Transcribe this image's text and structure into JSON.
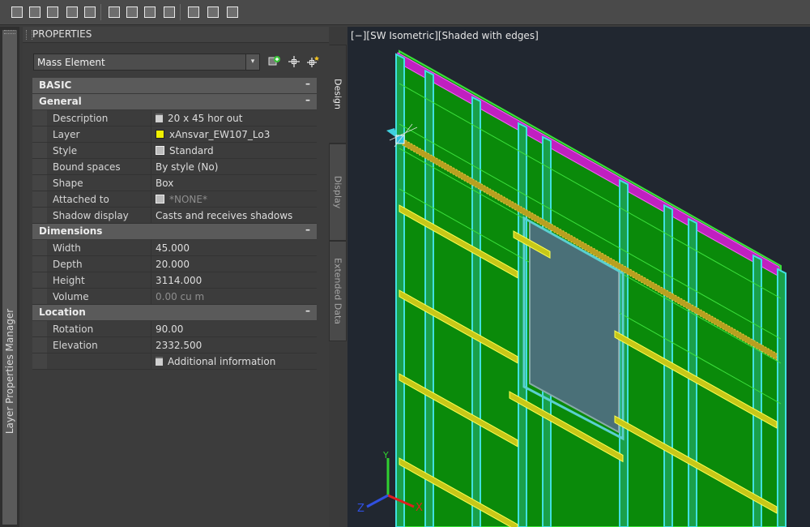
{
  "toolbar": {
    "buttons": [
      "new-object-icon",
      "refresh-icon",
      "zoom-icon",
      "edit-style-icon",
      "check-icon",
      "properties-edit-icon",
      "style-manager-icon",
      "display-manager-icon",
      "render-icon",
      "layer-icon",
      "command-line-icon",
      "settings-gear-icon"
    ]
  },
  "sidebar": {
    "label": "Layer Properties Manager"
  },
  "panel": {
    "title": "PROPERTIES",
    "object_type": "Mass Element",
    "buttons": [
      "select-objects-icon",
      "pick-point-icon",
      "quick-select-icon"
    ]
  },
  "grid": {
    "categories": [
      {
        "label": "BASIC",
        "symbol": "–",
        "top_level": true,
        "rows": []
      },
      {
        "label": "General",
        "symbol": "–",
        "rows": [
          {
            "name": "Description",
            "value": "20 x 45 hor out",
            "icon": "list-icon"
          },
          {
            "name": "Layer",
            "value": "xAnsvar_EW107_Lo3",
            "icon": "yellow-layer-swatch"
          },
          {
            "name": "Style",
            "value": "Standard",
            "icon": "style-icon"
          },
          {
            "name": "Bound spaces",
            "value": "By style (No)"
          },
          {
            "name": "Shape",
            "value": "Box"
          },
          {
            "name": "Attached to",
            "value": "*NONE*",
            "icon": "attach-icon",
            "dim": true
          },
          {
            "name": "Shadow display",
            "value": "Casts and receives shadows"
          }
        ]
      },
      {
        "label": "Dimensions",
        "symbol": "–",
        "rows": [
          {
            "name": "Width",
            "value": "45.000"
          },
          {
            "name": "Depth",
            "value": "20.000"
          },
          {
            "name": "Height",
            "value": "3114.000"
          },
          {
            "name": "Volume",
            "value": "0.00  cu m",
            "dim": true
          }
        ]
      },
      {
        "label": "Location",
        "symbol": "–",
        "rows": [
          {
            "name": "Rotation",
            "value": "90.00"
          },
          {
            "name": "Elevation",
            "value": "2332.500"
          },
          {
            "name": "",
            "value": "Additional information",
            "icon": "list-icon"
          }
        ]
      }
    ]
  },
  "tabs": [
    "Design",
    "Display",
    "Extended Data"
  ],
  "viewport": {
    "label": "[−][SW Isometric][Shaded with edges]",
    "colors": {
      "wall": "#0a8a0a",
      "stud": "#40e0e0",
      "batten": "#d8d820",
      "top_plate": "#c020c0",
      "window": "#4a7078"
    },
    "ucs": {
      "x": "X",
      "y": "Y",
      "z": "Z"
    }
  },
  "colors": {
    "layer_swatch": "#f0f000",
    "panel_bg": "#3c3c3c",
    "viewport_bg": "#212730"
  }
}
